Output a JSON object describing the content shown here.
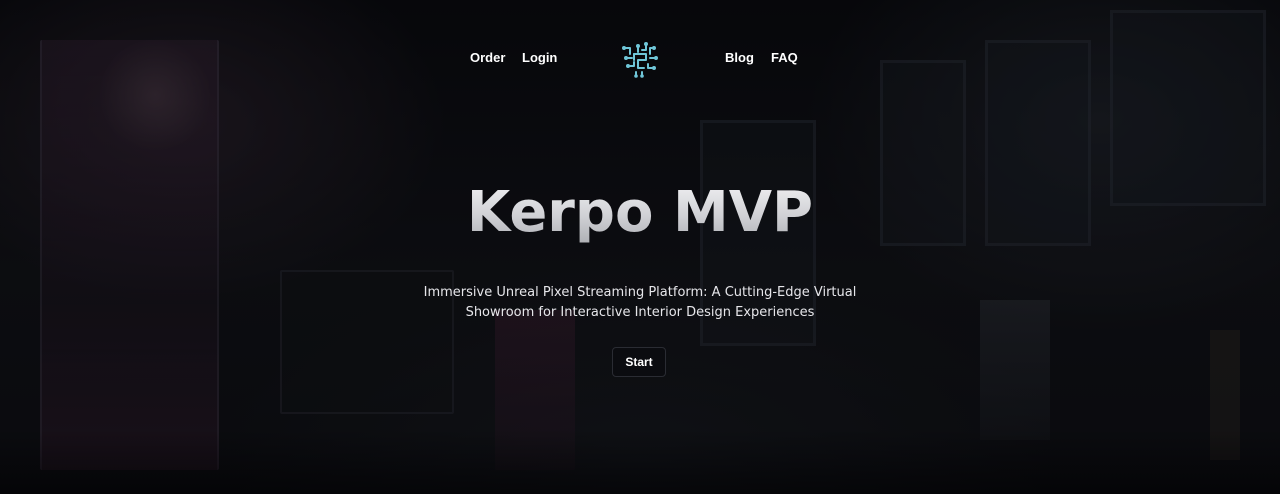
{
  "nav": {
    "left_links": [
      {
        "label": "Order"
      },
      {
        "label": "Login"
      }
    ],
    "right_links": [
      {
        "label": "Blog"
      },
      {
        "label": "FAQ"
      }
    ],
    "logo_icon": "circuit-logo-icon"
  },
  "hero": {
    "title": "Kerpo MVP",
    "subtitle_line1": "Immersive Unreal Pixel Streaming Platform: A Cutting-Edge Virtual",
    "subtitle_line2": "Showroom for Interactive Interior Design Experiences",
    "cta_label": "Start"
  },
  "colors": {
    "background": "#0a0b10",
    "text": "#ffffff",
    "logo_accent": "#6fc6d8"
  }
}
